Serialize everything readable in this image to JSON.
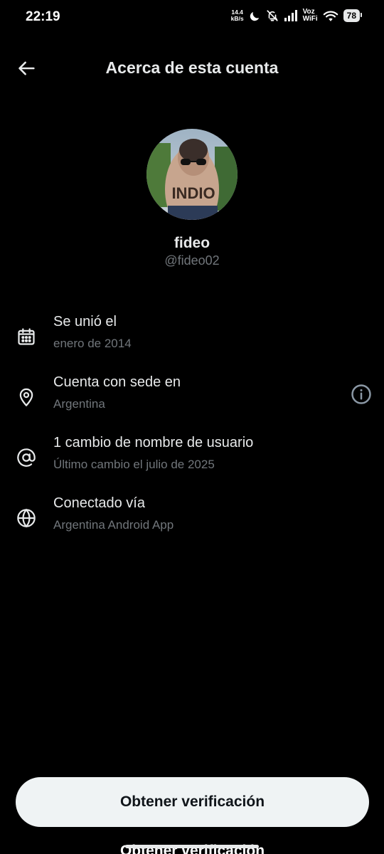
{
  "status_bar": {
    "time": "22:19",
    "net_speed_value": "14.4",
    "net_speed_unit": "kB/s",
    "voz": "Voz",
    "wifi": "WiFi",
    "battery": "78",
    "icons": [
      "moon-icon",
      "bell-off-icon",
      "signal-icon",
      "wifi-icon"
    ]
  },
  "header": {
    "title": "Acerca de esta cuenta",
    "back_icon": "arrow-left-icon"
  },
  "profile": {
    "display_name": "fideo",
    "handle": "@fideo02"
  },
  "info": [
    {
      "icon": "calendar-icon",
      "title": "Se unió el",
      "detail": "enero de 2014"
    },
    {
      "icon": "location-pin-icon",
      "title": "Cuenta con sede en",
      "detail": "Argentina",
      "info_icon": "info-circle-icon"
    },
    {
      "icon": "at-sign-icon",
      "title": "1 cambio de nombre de usuario",
      "detail": "Último cambio el julio de 2025"
    },
    {
      "icon": "globe-icon",
      "title": "Conectado vía",
      "detail": "Argentina Android App"
    }
  ],
  "footer": {
    "verify_label": "Obtener verificación"
  },
  "colors": {
    "background": "#000000",
    "primary_text": "#e7e9ea",
    "secondary_text": "#71767b",
    "button_bg": "#eff3f4",
    "button_text": "#0f1419"
  }
}
